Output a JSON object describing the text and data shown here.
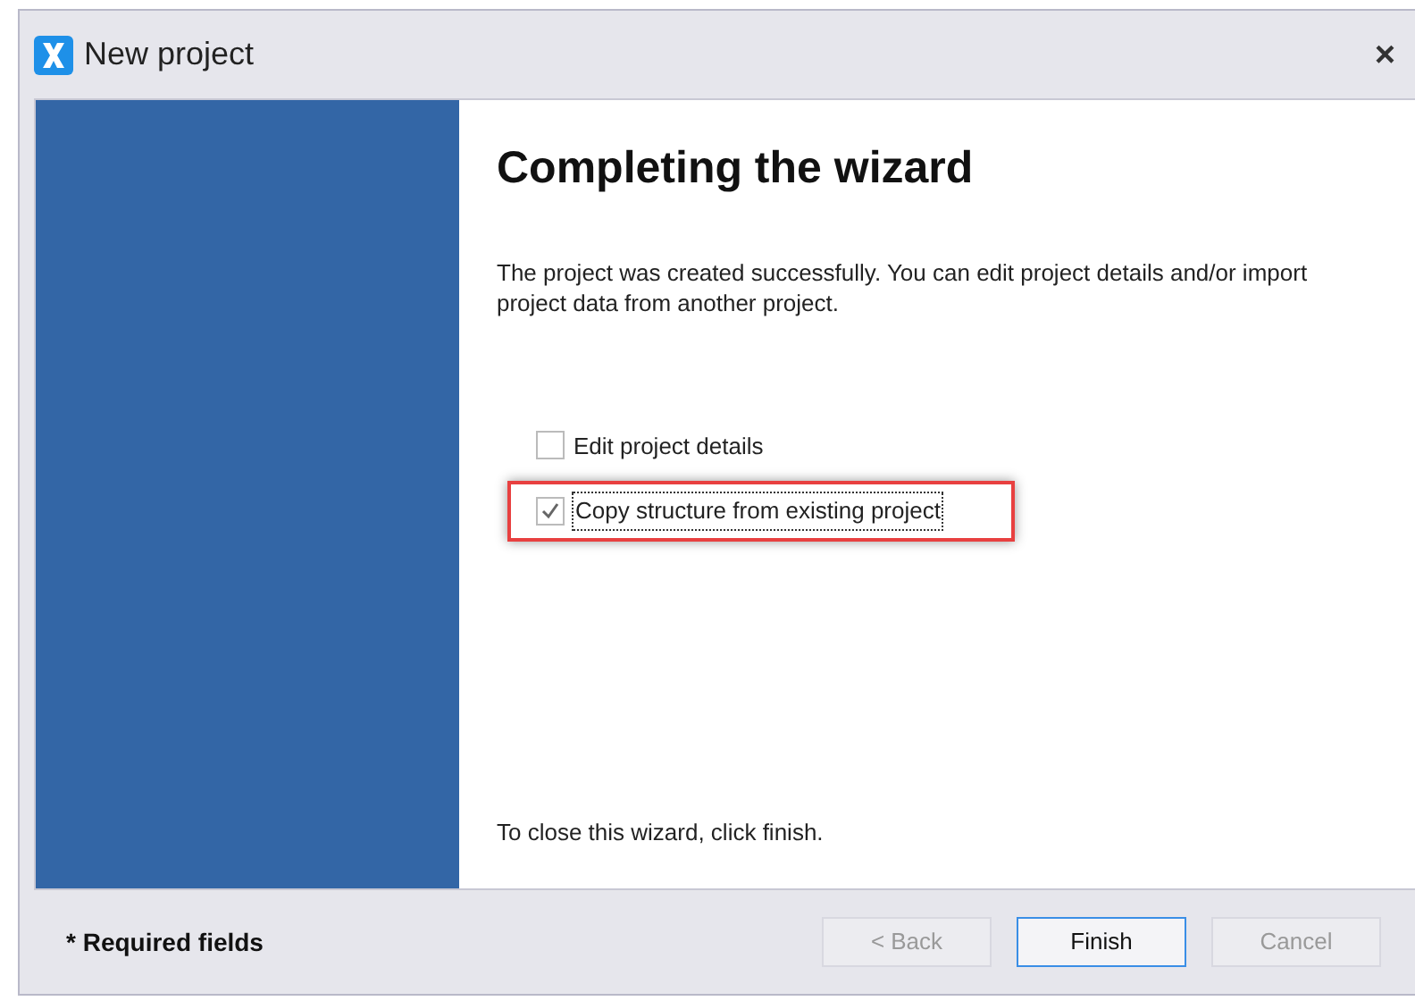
{
  "window": {
    "title": "New project",
    "close": "×"
  },
  "heading": "Completing the wizard",
  "description": "The project was created successfully. You can edit project details and/or import project data from another project.",
  "options": [
    {
      "label": "Edit project details",
      "checked": false,
      "highlighted": false
    },
    {
      "label": "Copy structure from existing project",
      "checked": true,
      "highlighted": true
    }
  ],
  "closing_note": "To close this wizard, click finish.",
  "footer": {
    "note": "* Required fields",
    "buttons": [
      {
        "label": "< Back",
        "disabled": true,
        "default": false
      },
      {
        "label": "Finish",
        "disabled": false,
        "default": true
      },
      {
        "label": "Cancel",
        "disabled": true,
        "default": false
      }
    ]
  }
}
